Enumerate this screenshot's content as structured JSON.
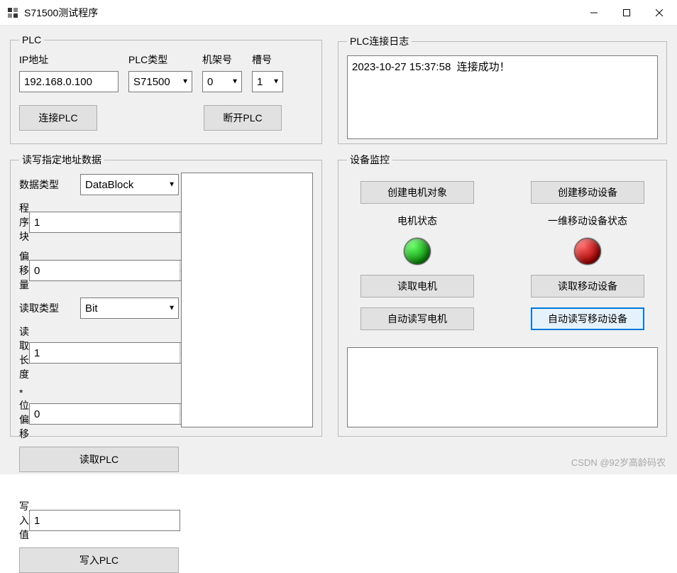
{
  "window": {
    "title": "S71500测试程序"
  },
  "plc": {
    "legend": "PLC",
    "ip_label": "IP地址",
    "ip_value": "192.168.0.100",
    "type_label": "PLC类型",
    "type_value": "S71500",
    "rack_label": "机架号",
    "rack_value": "0",
    "slot_label": "槽号",
    "slot_value": "1",
    "connect_btn": "连接PLC",
    "disconnect_btn": "断开PLC"
  },
  "log": {
    "legend": "PLC连接日志",
    "text": "2023-10-27 15:37:58  连接成功！"
  },
  "rw": {
    "legend": "读写指定地址数据",
    "datatype_label": "数据类型",
    "datatype_value": "DataBlock",
    "block_label": "程序块",
    "block_value": "1",
    "offset_label": "偏移量",
    "offset_value": "0",
    "readtype_label": "读取类型",
    "readtype_value": "Bit",
    "readlen_label": "读取长度",
    "readlen_value": "1",
    "bitoffset_label": "*位偏移",
    "bitoffset_value": "0",
    "read_btn": "读取PLC",
    "write_label": "写入值",
    "write_value": "1",
    "write_btn": "写入PLC"
  },
  "mon": {
    "legend": "设备监控",
    "create_motor_btn": "创建电机对象",
    "create_device_btn": "创建移动设备",
    "motor_status_label": "电机状态",
    "device_status_label": "一维移动设备状态",
    "read_motor_btn": "读取电机",
    "read_device_btn": "读取移动设备",
    "auto_motor_btn": "自动读写电机",
    "auto_device_btn": "自动读写移动设备"
  },
  "watermark": "CSDN @92岁高龄码农"
}
